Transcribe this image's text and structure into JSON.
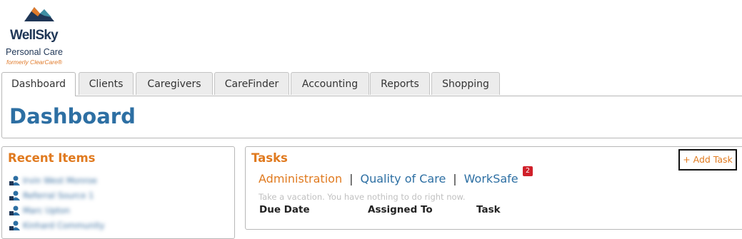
{
  "brand": {
    "name": "WellSky",
    "product": "Personal Care",
    "formerly": "formerly ClearCare®",
    "colors": {
      "navy": "#1f3656",
      "orange": "#e07a2a",
      "teal": "#3f8ea3"
    }
  },
  "tabs": [
    {
      "label": "Dashboard",
      "active": true
    },
    {
      "label": "Clients",
      "active": false
    },
    {
      "label": "Caregivers",
      "active": false
    },
    {
      "label": "CareFinder",
      "active": false
    },
    {
      "label": "Accounting",
      "active": false
    },
    {
      "label": "Reports",
      "active": false
    },
    {
      "label": "Shopping",
      "active": false
    }
  ],
  "page": {
    "title": "Dashboard"
  },
  "recent": {
    "title": "Recent Items",
    "items": [
      {
        "label": "Irvin West Monroe",
        "icon": "user-icon"
      },
      {
        "label": "Referral Source 1",
        "icon": "user-icon"
      },
      {
        "label": "Marc Upton",
        "icon": "user-icon"
      },
      {
        "label": "Kinhard Community",
        "icon": "user-icon"
      }
    ]
  },
  "tasks": {
    "title": "Tasks",
    "add_label": "+ Add Task",
    "filters": [
      {
        "label": "Administration",
        "active": true
      },
      {
        "label": "Quality of Care",
        "active": false
      },
      {
        "label": "WorkSafe",
        "active": false
      }
    ],
    "separator": "|",
    "worksafe_badge": "2",
    "empty_message": "Take a vacation. You have nothing to do right now.",
    "columns": [
      "Due Date",
      "Assigned To",
      "Task"
    ]
  },
  "colors": {
    "accent_orange": "#e07a1f",
    "link_blue": "#2d6fa3",
    "badge_red": "#d0202a"
  }
}
